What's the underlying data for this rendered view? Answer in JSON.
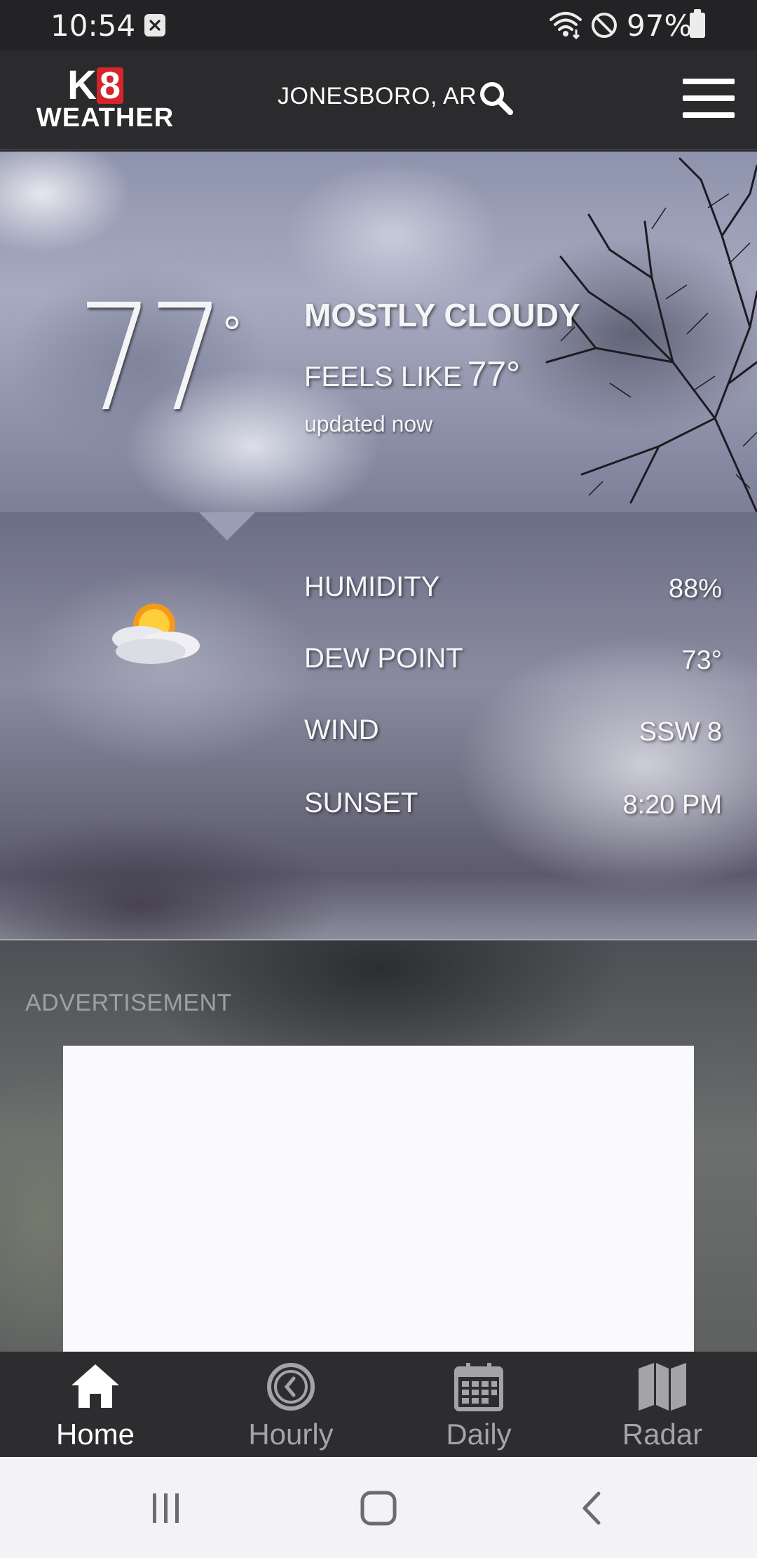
{
  "status_bar": {
    "time": "10:54",
    "battery": "97%",
    "icons": [
      "notification-x-icon",
      "wifi-icon",
      "do-not-disturb-icon",
      "battery-icon"
    ]
  },
  "header": {
    "logo_top": "K",
    "logo_number": "8",
    "logo_bottom": "WEATHER",
    "location": "JONESBORO, AR",
    "brand_color": "#d5242b"
  },
  "current": {
    "temperature": "77",
    "degree_symbol": "°",
    "condition": "MOSTLY CLOUDY",
    "feels_like_label": "FEELS LIKE",
    "feels_like_value": "77°",
    "updated": "updated now"
  },
  "details": [
    {
      "label": "HUMIDITY",
      "value": "88%"
    },
    {
      "label": "DEW POINT",
      "value": "73°"
    },
    {
      "label": "WIND",
      "value": "SSW 8"
    },
    {
      "label": "SUNSET",
      "value": "8:20 PM"
    }
  ],
  "advertisement": {
    "label": "ADVERTISEMENT"
  },
  "bottom_nav": {
    "items": [
      {
        "label": "Home",
        "icon": "home-icon",
        "active": true
      },
      {
        "label": "Hourly",
        "icon": "clock-icon",
        "active": false
      },
      {
        "label": "Daily",
        "icon": "calendar-icon",
        "active": false
      },
      {
        "label": "Radar",
        "icon": "map-icon",
        "active": false
      }
    ]
  },
  "system_nav": {
    "icons": [
      "recent-apps-icon",
      "home-circle-icon",
      "back-icon"
    ]
  }
}
